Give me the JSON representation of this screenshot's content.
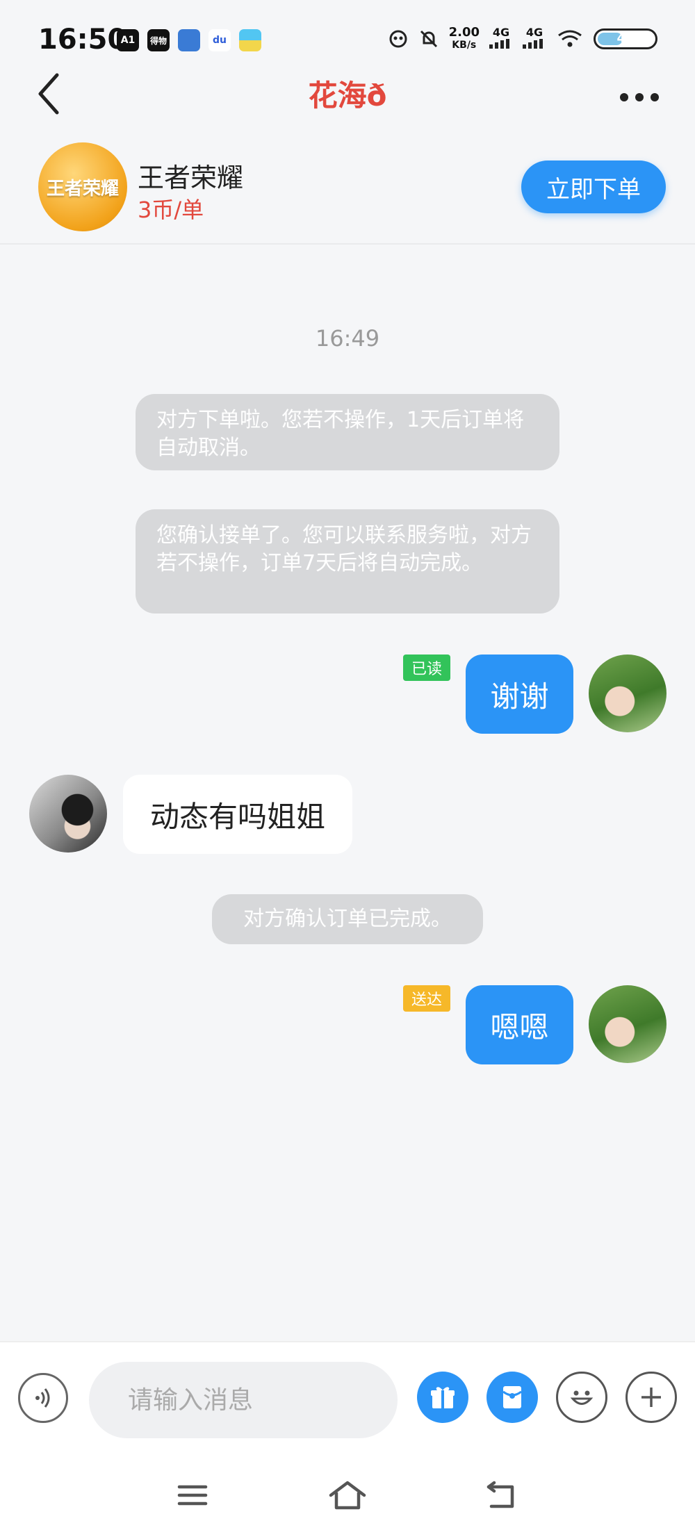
{
  "status_bar": {
    "time": "16:50",
    "apps": [
      {
        "name": "app-1",
        "label": "A1",
        "color": "#111111"
      },
      {
        "name": "app-2",
        "label": "得物",
        "color": "#111111"
      },
      {
        "name": "app-3",
        "label": "",
        "color": "#3a7bd5"
      },
      {
        "name": "app-4",
        "label": "du",
        "color": "#ffffff"
      },
      {
        "name": "app-5",
        "label": "",
        "color": "#52c6f2"
      }
    ],
    "speed_value": "2.00",
    "speed_unit": "KB/s",
    "net1": "4G",
    "net2": "4G",
    "battery": "47"
  },
  "header": {
    "title": "花海ð"
  },
  "product": {
    "logo_text": "王者荣耀",
    "name": "王者荣耀",
    "price": "3币/单",
    "order_button": "立即下单"
  },
  "chat": {
    "timestamp": "16:49",
    "system_messages": [
      "对方下单啦。您若不操作，1天后订单将自动取消。",
      "您确认接单了。您可以联系服务啦，对方若不操作，订单7天后将自动完成。",
      "对方确认订单已完成。"
    ],
    "messages": [
      {
        "sender": "me",
        "text": "谢谢",
        "status": "已读"
      },
      {
        "sender": "other",
        "text": "动态有吗姐姐"
      },
      {
        "sender": "me",
        "text": "嗯嗯",
        "status": "送达"
      }
    ]
  },
  "input_bar": {
    "placeholder": "请输入消息"
  },
  "colors": {
    "accent": "#2b94f6",
    "title": "#e2483d",
    "price": "#e2483d",
    "read_tag": "#32c35a",
    "sent_tag": "#f6b829"
  }
}
